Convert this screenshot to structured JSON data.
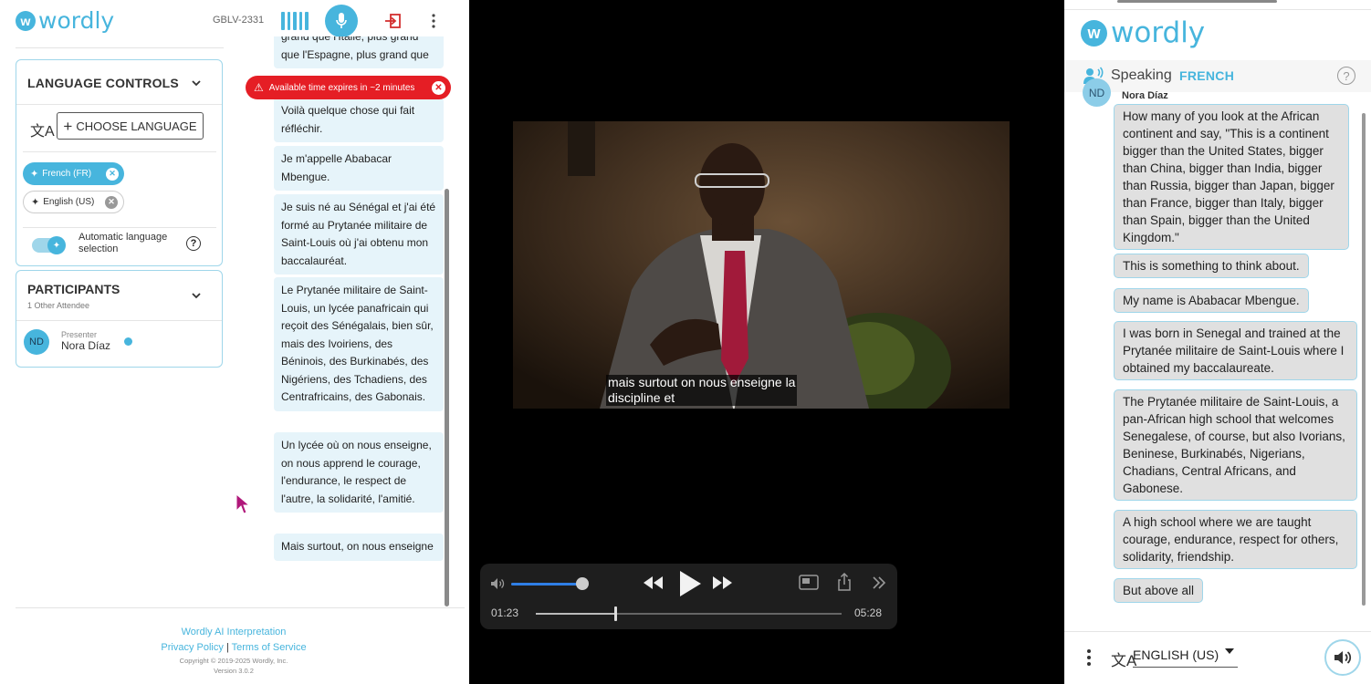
{
  "left": {
    "brand": "wordly",
    "brand_mark": "w",
    "session_code": "GBLV-2331",
    "language_controls": {
      "title": "LANGUAGE CONTROLS",
      "choose_button": "CHOOSE LANGUAGE",
      "languages": [
        {
          "label": "French (FR)",
          "active": true
        },
        {
          "label": "English (US)",
          "active": false
        }
      ],
      "auto_label": "Automatic language selection"
    },
    "participants": {
      "title": "PARTICIPANTS",
      "subtitle": "1 Other Attendee",
      "presenter": {
        "role": "Presenter",
        "name": "Nora Díaz",
        "initials": "ND"
      }
    },
    "alert": "Available time expires in ~2 minutes",
    "transcript": [
      "grand que l'Italie, plus grand que l'Espagne, plus grand que",
      "Voilà quelque chose qui fait réfléchir.",
      "Je m'appelle Ababacar Mbengue.",
      "Je suis né au Sénégal et j'ai été formé au Prytanée militaire de Saint-Louis où j'ai obtenu mon baccalauréat.",
      "Le Prytanée militaire de Saint-Louis, un lycée panafricain qui reçoit des Sénégalais, bien sûr, mais des Ivoiriens, des Béninois, des Burkinabés, des Nigériens, des Tchadiens, des Centrafricains, des Gabonais.",
      "Un lycée où on nous enseigne, on nous apprend le courage, l'endurance, le respect de l'autre, la solidarité, l'amitié.",
      "Mais surtout, on nous enseigne"
    ],
    "footer": {
      "product": "Wordly AI Interpretation",
      "privacy": "Privacy Policy",
      "separator": "|",
      "terms": "Terms of Service",
      "copyright": "Copyright © 2019-2025 Wordly, Inc.",
      "version": "Version 3.0.2"
    }
  },
  "video": {
    "subtitle_line1": "mais surtout on nous enseigne la",
    "subtitle_line2": "discipline et",
    "current_time": "01:23",
    "total_time": "05:28",
    "progress_fraction": 0.26,
    "volume_fraction": 0.98
  },
  "right": {
    "brand": "wordly",
    "brand_mark": "w",
    "speaking_label": "Speaking",
    "speaking_language": "FRENCH",
    "speaker_initials": "ND",
    "speaker_name": "Nora Díaz",
    "messages": [
      "How many of you look at the African continent and say, \"This is a continent bigger than the United States, bigger than China, bigger than India, bigger than Russia, bigger than Japan, bigger than France, bigger than Italy, bigger than Spain, bigger than the United Kingdom.\"",
      "This is something to think about.",
      "My name is Ababacar Mbengue.",
      "I was born in Senegal and trained at the Prytanée militaire de Saint-Louis where I obtained my baccalaureate.",
      "The Prytanée militaire de Saint-Louis, a pan-African high school that welcomes Senegalese, of course, but also Ivorians, Beninese, Burkinabés, Nigerians, Chadians, Central Africans, and Gabonese.",
      "A high school where we are taught courage, endurance, respect for others, solidarity, friendship.",
      "But above all"
    ],
    "output_language": "ENGLISH (US)"
  },
  "colors": {
    "brand": "#47b5dd",
    "alert": "#e51e25",
    "bubble_left": "#e6f4fa",
    "bubble_right": "#e0e0e0"
  }
}
